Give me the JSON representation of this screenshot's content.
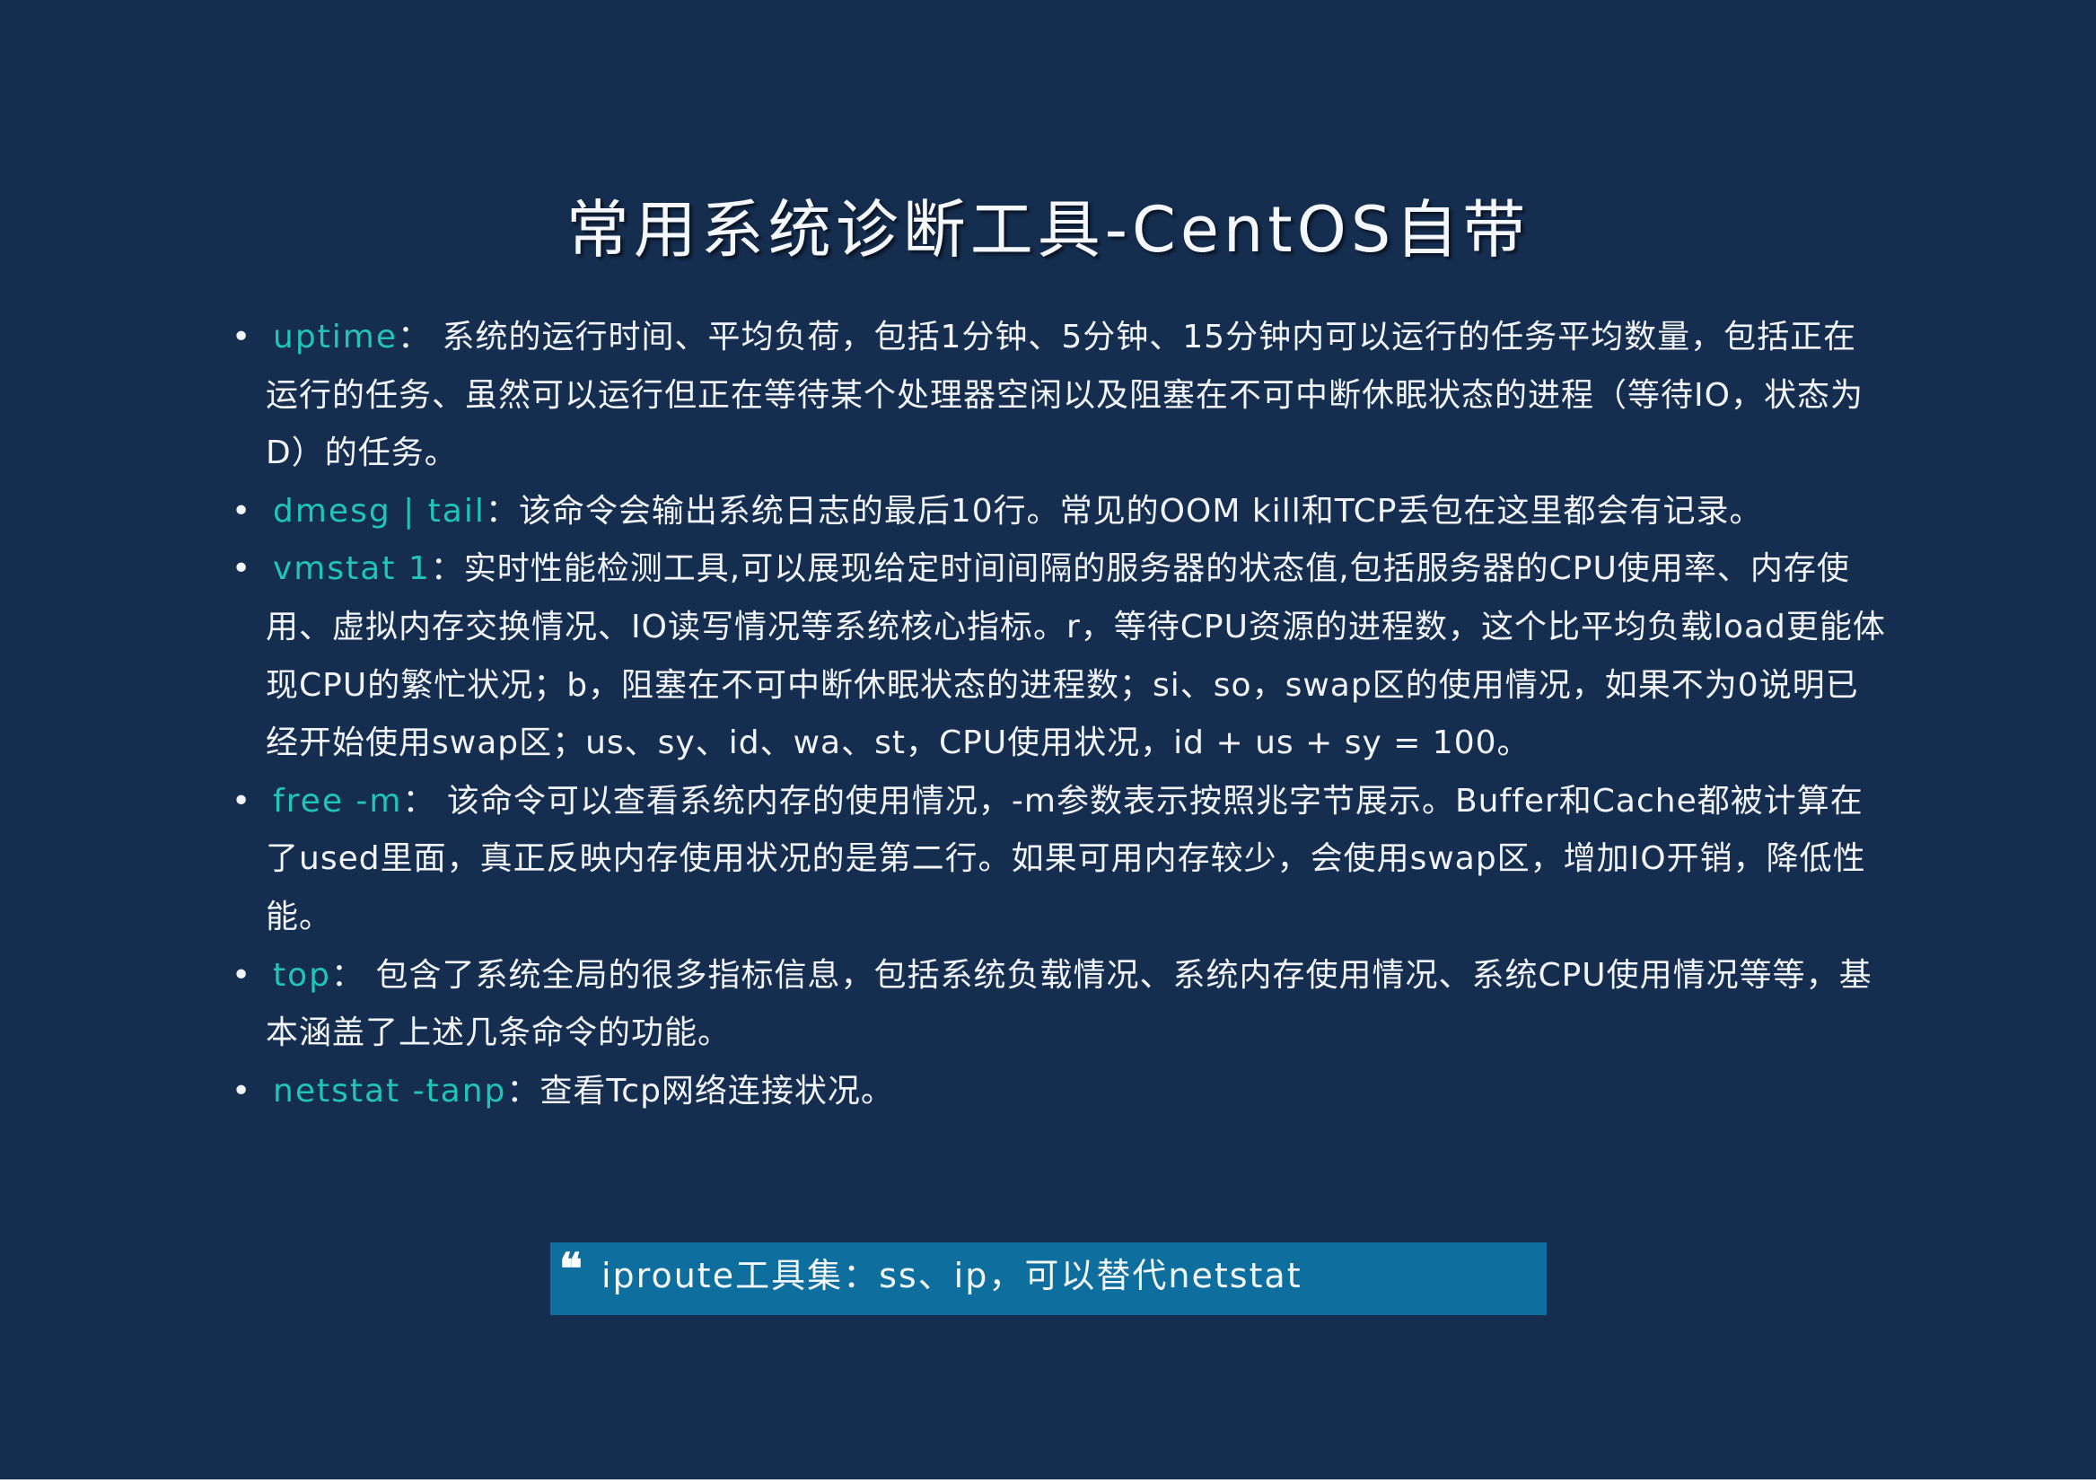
{
  "slide": {
    "title": "常用系统诊断工具-CentOS自带",
    "bullets": [
      {
        "command": "uptime",
        "description": "： 系统的运行时间、平均负荷，包括1分钟、5分钟、15分钟内可以运行的任务平均数量，包括正在运行的任务、虽然可以运行但正在等待某个处理器空闲以及阻塞在不可中断休眠状态的进程（等待IO，状态为D）的任务。"
      },
      {
        "command": "dmesg | tail",
        "description": "：该命令会输出系统日志的最后10行。常见的OOM kill和TCP丢包在这里都会有记录。"
      },
      {
        "command": "vmstat 1",
        "description": "：实时性能检测工具,可以展现给定时间间隔的服务器的状态值,包括服务器的CPU使用率、内存使用、虚拟内存交换情况、IO读写情况等系统核心指标。r，等待CPU资源的进程数，这个比平均负载load更能体现CPU的繁忙状况；b，阻塞在不可中断休眠状态的进程数；si、so，swap区的使用情况，如果不为0说明已经开始使用swap区；us、sy、id、wa、st，CPU使用状况，id + us + sy = 100。"
      },
      {
        "command": "free -m",
        "description": "： 该命令可以查看系统内存的使用情况，-m参数表示按照兆字节展示。Buffer和Cache都被计算在了used里面，真正反映内存使用状况的是第二行。如果可用内存较少，会使用swap区，增加IO开销，降低性能。"
      },
      {
        "command": "top",
        "description": "： 包含了系统全局的很多指标信息，包括系统负载情况、系统内存使用情况、系统CPU使用情况等等，基本涵盖了上述几条命令的功能。"
      },
      {
        "command": "netstat -tanp",
        "description": "：查看Tcp网络连接状况。"
      }
    ],
    "quote": "iproute工具集：ss、ip，可以替代netstat"
  },
  "colors": {
    "background": "#152d4f",
    "command": "#1fc6b8",
    "quote_box": "#0e6e9d",
    "text": "#f1f4f8"
  },
  "icons": {
    "bullet": "bullet-dot-icon",
    "quote": "quote-mark-icon"
  }
}
